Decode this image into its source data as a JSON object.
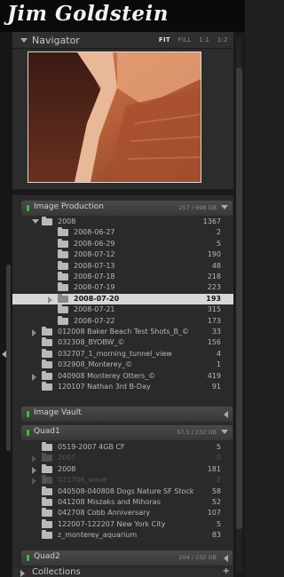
{
  "identity": {
    "signature": "Jim Goldstein"
  },
  "navigator": {
    "title": "Navigator",
    "zoom": [
      "FIT",
      "FILL",
      "1:1",
      "1:2"
    ],
    "zoom_active": "FIT"
  },
  "volumes": [
    {
      "name": "Image Production",
      "size": "257 / 698 GB",
      "status_color": "#3dbb3d",
      "rows": [
        {
          "label": "2008",
          "count": "1367",
          "level": 1,
          "arrow": "down"
        },
        {
          "label": "2008-06-27",
          "count": "2",
          "level": 2
        },
        {
          "label": "2008-06-29",
          "count": "5",
          "level": 2
        },
        {
          "label": "2008-07-12",
          "count": "190",
          "level": 2
        },
        {
          "label": "2008-07-13",
          "count": "48",
          "level": 2
        },
        {
          "label": "2008-07-18",
          "count": "218",
          "level": 2
        },
        {
          "label": "2008-07-19",
          "count": "223",
          "level": 2
        },
        {
          "label": "2008-07-20",
          "count": "193",
          "level": 2,
          "selected": true,
          "arrow": "right"
        },
        {
          "label": "2008-07-21",
          "count": "315",
          "level": 2
        },
        {
          "label": "2008-07-22",
          "count": "173",
          "level": 2
        },
        {
          "label": "012008 Baker Beach Test Shots_B_©",
          "count": "33",
          "level": 1,
          "arrow": "right"
        },
        {
          "label": "032308_BYOBW_©",
          "count": "156",
          "level": 1
        },
        {
          "label": "032707_1_morning_tunnel_view",
          "count": "4",
          "level": 1
        },
        {
          "label": "032908_Monterey_©",
          "count": "1",
          "level": 1
        },
        {
          "label": "040908 Monterey Otters_©",
          "count": "419",
          "level": 1,
          "arrow": "right"
        },
        {
          "label": "120107 Nathan 3rd B-Day",
          "count": "91",
          "level": 1
        }
      ]
    },
    {
      "name": "Image Vault",
      "size": "",
      "status_color": "#3dbb3d",
      "rows": []
    },
    {
      "name": "Quad1",
      "size": "57.5 / 232 GB",
      "status_color": "#3dbb3d",
      "rows": [
        {
          "label": "0519-2007 4GB CF",
          "count": "5",
          "level": 1
        },
        {
          "label": "2007",
          "count": "0",
          "level": 1,
          "dim": true,
          "arrow": "right"
        },
        {
          "label": "2008",
          "count": "181",
          "level": 1,
          "arrow": "right"
        },
        {
          "label": "021706_wave",
          "count": "2",
          "level": 1,
          "dim": true,
          "arrow": "right",
          "missing": true
        },
        {
          "label": "040508-040808 Dogs Nature SF Stock",
          "count": "58",
          "level": 1
        },
        {
          "label": "041208 Miszaks and Mihoras",
          "count": "52",
          "level": 1
        },
        {
          "label": "042708 Cobb Anniversary",
          "count": "107",
          "level": 1
        },
        {
          "label": "122007-122207 New York City",
          "count": "5",
          "level": 1
        },
        {
          "label": "z_monterey_aquarium",
          "count": "83",
          "level": 1
        }
      ]
    },
    {
      "name": "Quad2",
      "size": "204 / 232 GB",
      "status_color": "#3dbb3d",
      "rows": []
    }
  ],
  "collections": {
    "title": "Collections",
    "add_label": "+"
  }
}
